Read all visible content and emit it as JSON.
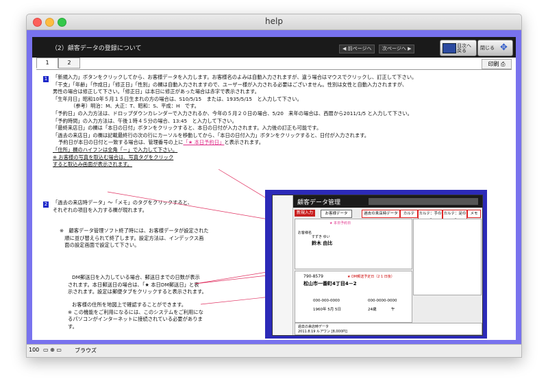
{
  "window": {
    "title": "help"
  },
  "header": {
    "title": "（2）顧客データの登録について",
    "prev": "◀ 前ページへ",
    "next": "次ページへ ▶",
    "btn_index": "目次へ 戻る",
    "btn_close": "閉じる"
  },
  "tabs": [
    "1",
    "2"
  ],
  "print": "印刷",
  "markers": [
    "1",
    "2"
  ],
  "text1": [
    "「新規入力」ボタンをクリックしてから、お客様データを入力します。お客様名のよみは自動入力されますが、違う場合はマウスでクリックし、訂正して下さい。",
    "「干支」「年齢」「作成日」「修正日」「性別」の欄は自動入力されますので、ユーザー様が入力される必要はございません。性別は女性と自動入力されますが、",
    "男性の場合は修正して下さい。「修正日」は本日に修正があった場合は赤字で表示されます。",
    "「生年月日」昭和10年５月１５日生まれの方の場合は、S10/5/15　または、1935/5/15　と入力して下さい。",
    "（参考）明治：M、大正：T、昭和：S、平成：H　です。",
    "「予約日」の入力方法は、ドロップダウンカレンダーで入力されるか、今年の５月２０日の場合、5/20　来年の場合は、西暦から2011/1/5 と入力して下さい。",
    "「予約時間」の入力方法は、午後１時４５分の場合、13:45　と入力して下さい。",
    "「最終来店日」の欄は「本日の日付」ボタンをクリックすると、本日の日付が入力されます。入力後の訂正も可能です。",
    "「過去の来店日」の欄は記載最終行の次の行にカーソルを移動してから、「本日の日付入力」ボタンをクリックすると、日付が入力されます。"
  ],
  "text1b_pre": "予約日が本日の日付と一致する場合は、管理番号の上に",
  "text1b_mark": "「★ 本日予約日」",
  "text1b_post": "と表示されます。",
  "text1c": [
    "「住所」欄のハイフンは全角「－」で入力して下さい。",
    "※ お客様の写真を取込む場合は、写真タグをクリック",
    "すると取込み画面が表示されます。"
  ],
  "text2": [
    "「過去の来店時データ」～「メモ」のタグをクリックすると、",
    "それぞれの項目を入力する欄が現れます。"
  ],
  "text3": [
    "※　顧客データ管理ソフト終了時には、お客様データが設定された",
    "　順に並び替えられて終了します。設定方法は、インデックス画",
    "　面の設定画面で設定して下さい。"
  ],
  "text4": [
    "DM郵送日を入力している場合、郵送日までの日数が表示",
    "されます。本日郵送日の場合は、「★ 本日DM郵送日」と表",
    "示されます。設定は郵便タブをクリックすると表示されます。"
  ],
  "text5": [
    "お客様の住所を地図上で確認することができます。",
    "※ この機能をご利用になるには、このシステムをご利用にな",
    "るパソコンがインターネットに接続されている必要がありま",
    "す。"
  ],
  "shot": {
    "app_title": "顧客データ管理",
    "new_btn": "新規入力",
    "tabs": [
      "お客様データ",
      "過去の来店時データ",
      "カルテ",
      "カルテ：手の爪",
      "カルテ：足の爪",
      "メモ"
    ],
    "name_label": "お客様名",
    "name_value": "鈴木 由比",
    "kana": "すずき ゆい",
    "today_mark": "★ 本日予約日",
    "postal": "790-8579",
    "address": "松山市一番町4丁目4－2",
    "dm_mark": "★ DM郵送予定日（2 1 日後）",
    "phone1": "000-000-0000",
    "phone2": "000-0000-0000",
    "birth": "1960年 5月 5日",
    "age": "24歳",
    "zodiac": "午",
    "history_title": "過去の来店時データ",
    "history_row": "2011.8.19 ルアワン [8,000円]",
    "status_percent": "ブラウズ"
  },
  "status": {
    "zoom": "100",
    "mode": "ブラウズ"
  }
}
